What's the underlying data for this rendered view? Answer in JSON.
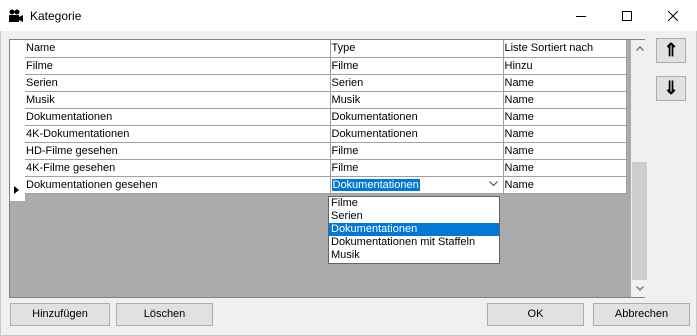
{
  "window": {
    "title": "Kategorie",
    "icon": "camera-icon"
  },
  "grid": {
    "columns": [
      "Name",
      "Type",
      "Liste Sortiert nach"
    ],
    "rows": [
      {
        "name": "Filme",
        "type": "Filme",
        "sort": "Hinzu"
      },
      {
        "name": "Serien",
        "type": "Serien",
        "sort": "Name"
      },
      {
        "name": "Musik",
        "type": "Musik",
        "sort": "Name"
      },
      {
        "name": "Dokumentationen",
        "type": "Dokumentationen",
        "sort": "Name"
      },
      {
        "name": "4K-Dokumentationen",
        "type": "Dokumentationen",
        "sort": "Name"
      },
      {
        "name": "HD-Filme gesehen",
        "type": "Filme",
        "sort": "Name"
      },
      {
        "name": "4K-Filme gesehen",
        "type": "Filme",
        "sort": "Name"
      },
      {
        "name": "Dokumentationen gesehen",
        "type": "Dokumentationen",
        "sort": "Name"
      }
    ],
    "current_row_index": 7
  },
  "dropdown": {
    "options": [
      "Filme",
      "Serien",
      "Dokumentationen",
      "Dokumentationen mit Staffeln",
      "Musik"
    ],
    "selected_index": 2
  },
  "side_buttons": {
    "up_label": "⇑",
    "down_label": "⇓"
  },
  "buttons": {
    "add": "Hinzufügen",
    "delete": "Löschen",
    "ok": "OK",
    "cancel": "Abbrechen"
  },
  "colors": {
    "selection": "#0078d7",
    "button_face": "#e1e1e1",
    "grid_background": "#ababab"
  }
}
